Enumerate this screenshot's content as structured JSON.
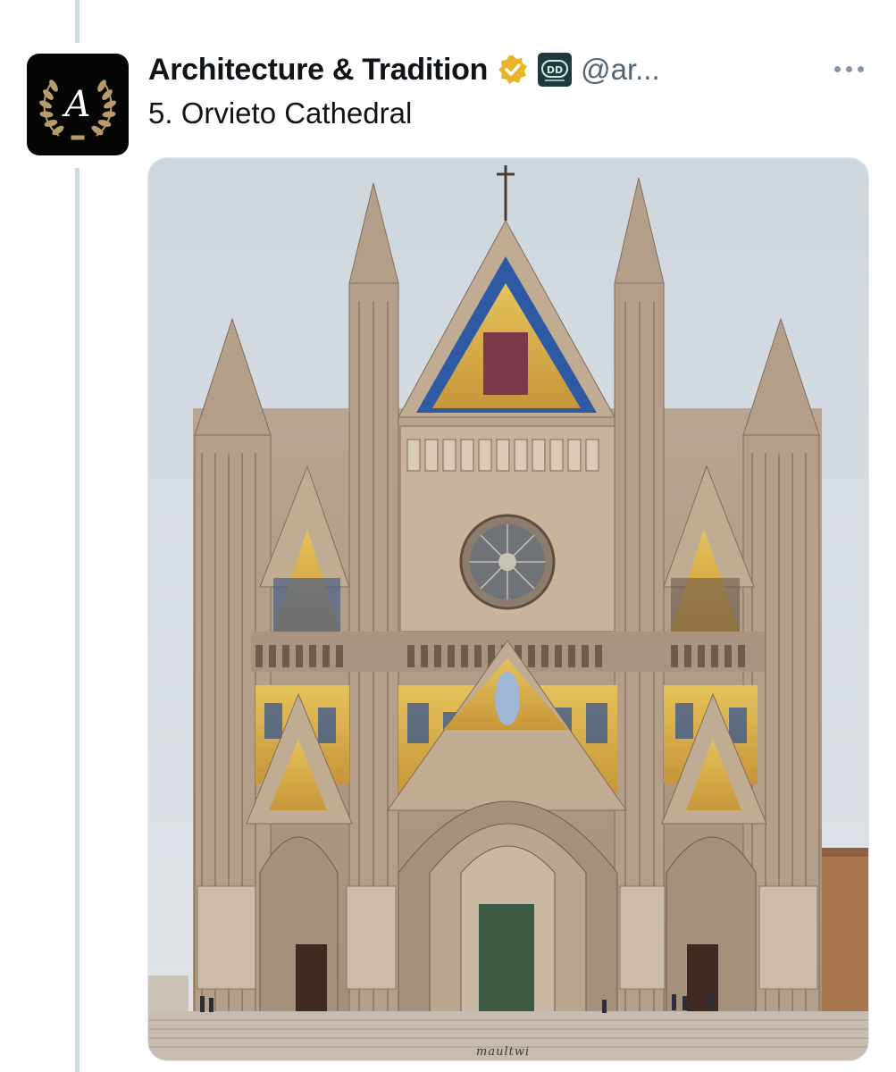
{
  "tweet": {
    "display_name": "Architecture & Tradition",
    "handle": "@ar...",
    "verified_badge": "gold-check-badge",
    "affiliate_badge": "DD",
    "text": "5. Orvieto Cathedral",
    "more_icon": "more-dots-icon"
  },
  "avatar": {
    "monogram": "A",
    "icon": "laurel-wreath-icon"
  },
  "media": {
    "description_icon": "cathedral-photo",
    "watermark": "maultwi"
  },
  "colors": {
    "gold": "#e8b52a",
    "handle_gray": "#536471",
    "thread_line": "#cfd9de"
  }
}
